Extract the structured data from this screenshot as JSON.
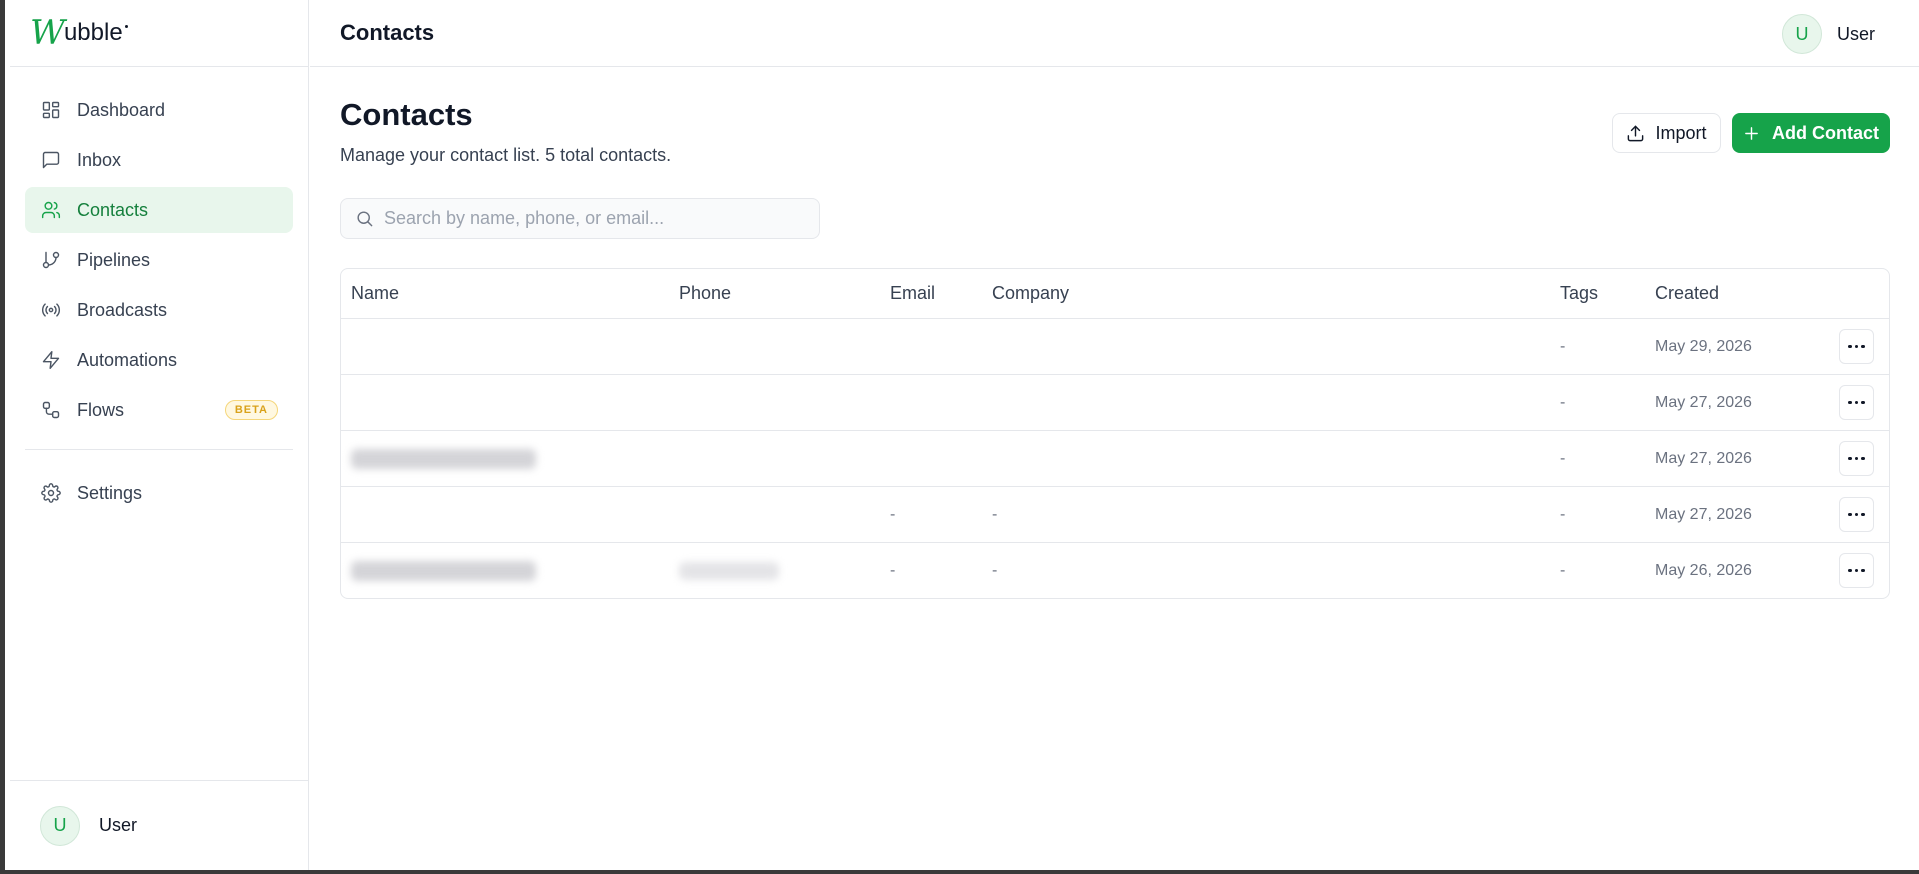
{
  "app": {
    "logo_mark": "W",
    "logo_text": "ubble",
    "brand_color": "#16a34a"
  },
  "sidebar": {
    "items": [
      {
        "label": "Dashboard",
        "icon": "dashboard-icon"
      },
      {
        "label": "Inbox",
        "icon": "message-square-icon"
      },
      {
        "label": "Contacts",
        "icon": "users-icon",
        "active": true
      },
      {
        "label": "Pipelines",
        "icon": "git-branch-icon"
      },
      {
        "label": "Broadcasts",
        "icon": "radio-icon"
      },
      {
        "label": "Automations",
        "icon": "zap-icon"
      },
      {
        "label": "Flows",
        "icon": "workflow-icon",
        "badge": "BETA"
      }
    ],
    "settings_label": "Settings",
    "user": {
      "initial": "U",
      "name": "User"
    }
  },
  "header": {
    "title": "Contacts",
    "user": {
      "initial": "U",
      "name": "User"
    }
  },
  "main": {
    "title": "Contacts",
    "subtitle": "Manage your contact list. 5 total contacts.",
    "import_label": "Import",
    "add_label": "Add Contact",
    "search": {
      "placeholder": "Search by name, phone, or email...",
      "value": ""
    }
  },
  "table": {
    "columns": [
      "Name",
      "Phone",
      "Email",
      "Company",
      "Tags",
      "Created"
    ],
    "rows": [
      {
        "email": "",
        "company": "",
        "tags": "-",
        "created": "May 29, 2026"
      },
      {
        "email": "",
        "company": "",
        "tags": "-",
        "created": "May 27, 2026"
      },
      {
        "email": "",
        "company": "",
        "tags": "-",
        "created": "May 27, 2026"
      },
      {
        "email": "-",
        "company": "-",
        "tags": "-",
        "created": "May 27, 2026"
      },
      {
        "email": "-",
        "company": "-",
        "tags": "-",
        "created": "May 26, 2026"
      }
    ]
  }
}
